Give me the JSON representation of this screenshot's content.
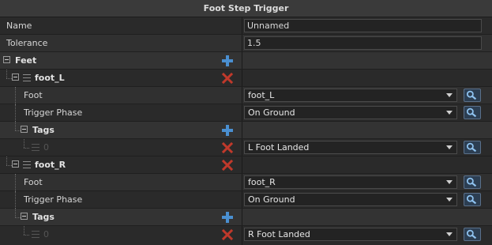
{
  "panel": {
    "title": "Foot Step Trigger"
  },
  "fields": {
    "name": {
      "label": "Name",
      "value": "Unnamed"
    },
    "tolerance": {
      "label": "Tolerance",
      "value": "1.5"
    }
  },
  "feet": {
    "label": "Feet",
    "items": [
      {
        "label": "foot_L",
        "foot": {
          "label": "Foot",
          "value": "foot_L"
        },
        "phase": {
          "label": "Trigger Phase",
          "value": "On Ground"
        },
        "tags": {
          "label": "Tags",
          "index": "0",
          "value": "L Foot Landed"
        }
      },
      {
        "label": "foot_R",
        "foot": {
          "label": "Foot",
          "value": "foot_R"
        },
        "phase": {
          "label": "Trigger Phase",
          "value": "On Ground"
        },
        "tags": {
          "label": "Tags",
          "index": "0",
          "value": "R Foot Landed"
        }
      }
    ]
  },
  "icons": {
    "add": "plus-icon",
    "remove": "x-icon",
    "search": "magnifier-icon",
    "expander": "collapse-minus-icon",
    "drag": "drag-handle-icon"
  },
  "colors": {
    "add": "#4a8fd0",
    "remove": "#c0392b",
    "search_bg": "#2c3e52"
  }
}
